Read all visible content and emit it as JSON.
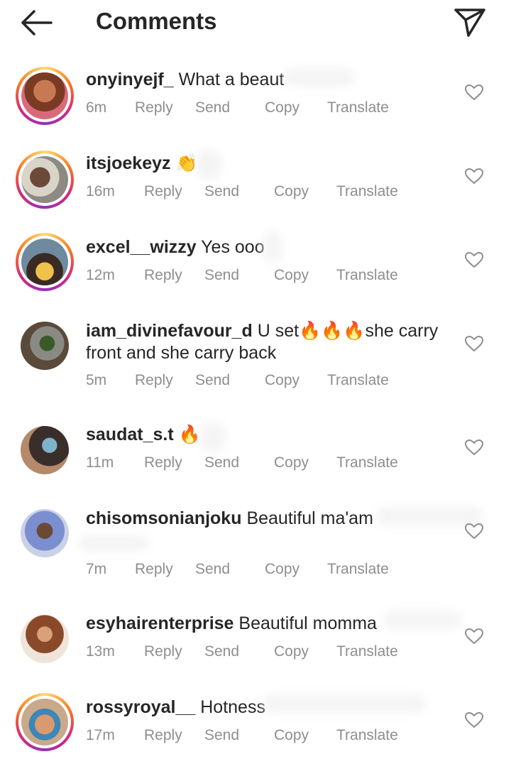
{
  "header": {
    "title": "Comments",
    "back_icon": "arrow-left-icon",
    "share_icon": "paper-plane-icon"
  },
  "actions": {
    "reply": "Reply",
    "send": "Send",
    "copy": "Copy",
    "translate": "Translate"
  },
  "comments": [
    {
      "username": "onyinyejf_",
      "text": "What a beaut",
      "time": "6m",
      "story_ring": true
    },
    {
      "username": "itsjoekeyz",
      "text": "👏",
      "time": "16m",
      "story_ring": true
    },
    {
      "username": "excel__wizzy",
      "text": "Yes ooo",
      "time": "12m",
      "story_ring": true
    },
    {
      "username": "iam_divinefavour_d",
      "text": "U set🔥🔥🔥she carry front and she carry back",
      "time": "5m",
      "story_ring": false
    },
    {
      "username": "saudat_s.t",
      "text": "🔥",
      "time": "11m",
      "story_ring": false
    },
    {
      "username": "chisomsonianjoku",
      "text": "Beautiful ma'am",
      "time": "7m",
      "story_ring": false
    },
    {
      "username": "esyhairenterprise",
      "text": "Beautiful momma",
      "time": "13m",
      "story_ring": false
    },
    {
      "username": "rossyroyal__",
      "text": "Hotness",
      "time": "17m",
      "story_ring": true
    }
  ],
  "colors": {
    "text": "#262626",
    "meta": "#8e8e8e",
    "fire": "#ff6a1a",
    "ring_start": "#feda75",
    "ring_end": "#d62976"
  }
}
